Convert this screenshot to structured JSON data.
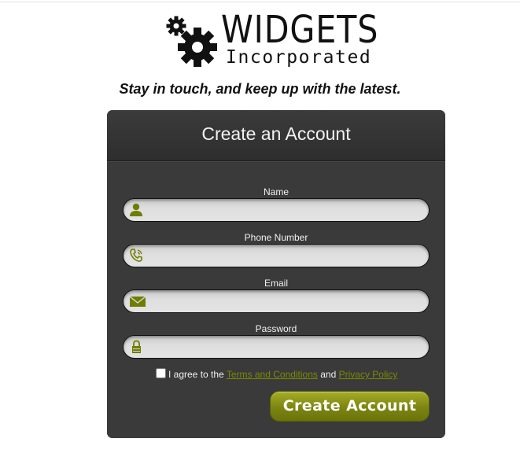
{
  "logo": {
    "brand": "WIDGETS",
    "subtitle": "Incorporated"
  },
  "tagline": "Stay in touch, and keep up with the latest.",
  "form": {
    "title": "Create an Account",
    "fields": [
      {
        "label": "Name",
        "icon": "user-icon",
        "value": "",
        "placeholder": ""
      },
      {
        "label": "Phone Number",
        "icon": "phone-icon",
        "value": "",
        "placeholder": ""
      },
      {
        "label": "Email",
        "icon": "envelope-icon",
        "value": "",
        "placeholder": ""
      },
      {
        "label": "Password",
        "icon": "lock-icon",
        "value": "",
        "placeholder": ""
      }
    ],
    "agree": {
      "prefix": "I agree to the",
      "terms": "Terms and Conditions",
      "and": "and",
      "privacy": "Privacy Policy",
      "checked": false
    },
    "submit_label": "Create Account"
  },
  "colors": {
    "accent": "#7a8a00",
    "panel": "#3a3a3a",
    "button": "#7c8512"
  }
}
